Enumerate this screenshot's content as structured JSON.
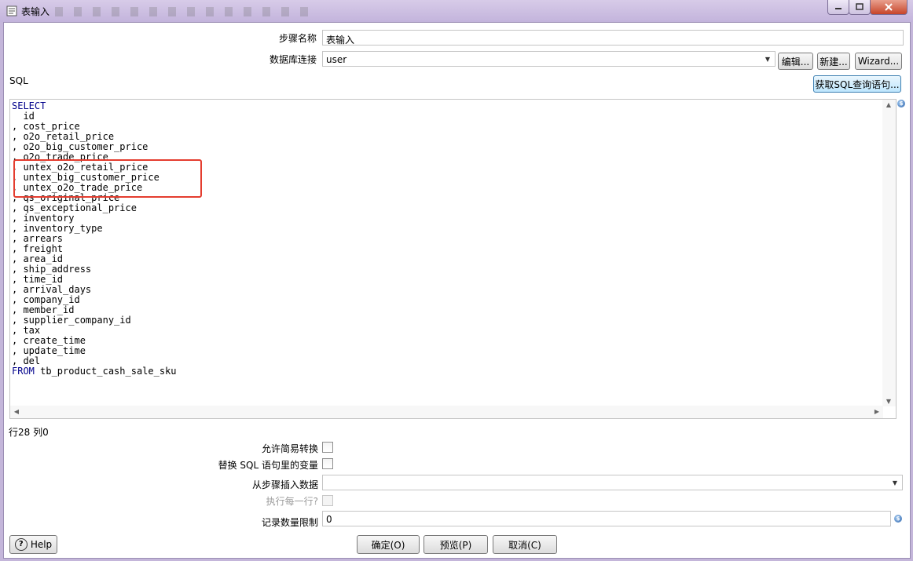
{
  "window": {
    "title": "表输入"
  },
  "form": {
    "step_name_label": "步骤名称",
    "step_name_value": "表输入",
    "db_connection_label": "数据库连接",
    "db_connection_value": "user",
    "edit_button": "编辑...",
    "new_button": "新建...",
    "wizard_button": "Wizard...",
    "sql_label": "SQL",
    "get_sql_button": "获取SQL查询语句...",
    "position_text": "行28 列0",
    "lazy_conversion_label": "允许简易转换",
    "replace_vars_label": "替换 SQL 语句里的变量",
    "insert_from_step_label": "从步骤插入数据",
    "insert_from_step_value": "",
    "execute_each_row_label": "执行每一行?",
    "limit_label": "记录数量限制",
    "limit_value": "0",
    "variable_icon": "dollar-icon"
  },
  "sql": {
    "lines": [
      "SELECT",
      "  id",
      ", cost_price",
      ", o2o_retail_price",
      ", o2o_big_customer_price",
      ", o2o_trade_price",
      ", untex_o2o_retail_price",
      ", untex_big_customer_price",
      ", untex_o2o_trade_price",
      ", qs_original_price",
      ", qs_exceptional_price",
      ", inventory",
      ", inventory_type",
      ", arrears",
      ", freight",
      ", area_id",
      ", ship_address",
      ", time_id",
      ", arrival_days",
      ", company_id",
      ", member_id",
      ", supplier_company_id",
      ", tax",
      ", create_time",
      ", update_time",
      ", del",
      "FROM tb_product_cash_sale_sku"
    ],
    "highlight_color": "#e43d2f"
  },
  "buttons": {
    "help": "Help",
    "ok": "确定(O)",
    "preview": "预览(P)",
    "cancel": "取消(C)"
  }
}
